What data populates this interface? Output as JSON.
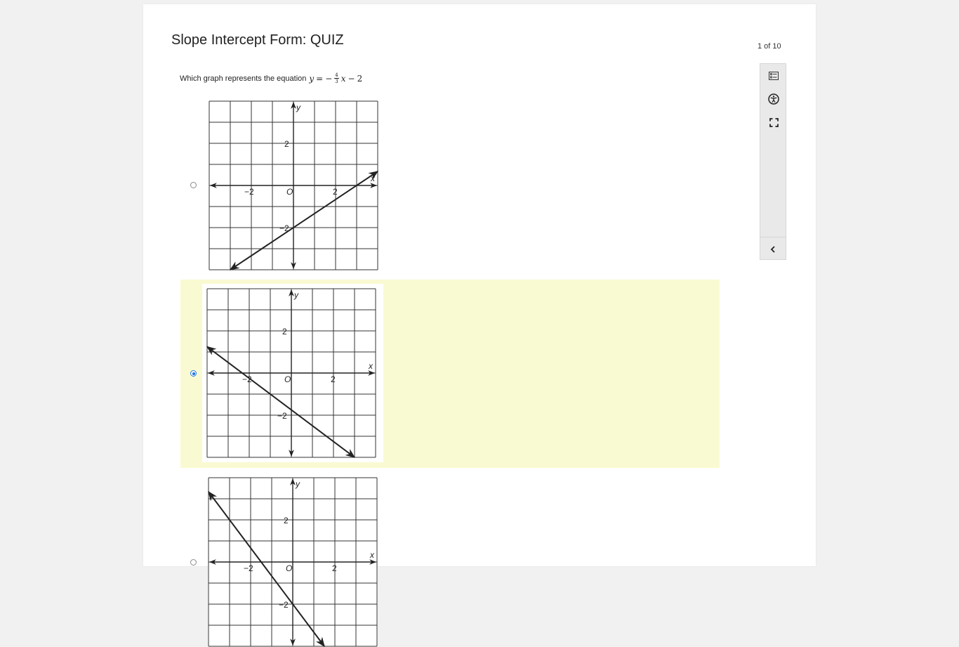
{
  "quiz": {
    "title": "Slope Intercept Form: QUIZ",
    "counter": "1 of 10"
  },
  "question": {
    "text": "Which graph represents the equation",
    "equation": {
      "lhs": "y",
      "equals": "=",
      "sign": "−",
      "numerator": "4",
      "denominator": "3",
      "variable": "x",
      "op": "−",
      "constant": "2"
    }
  },
  "options": [
    {
      "selected": false,
      "labels": {
        "y": "y",
        "x": "x",
        "origin": "O",
        "neg2": "−2",
        "pos2": "2"
      },
      "line": {
        "slope": 0.6667,
        "intercept": -2
      }
    },
    {
      "selected": true,
      "labels": {
        "y": "y",
        "x": "x",
        "origin": "O",
        "neg2": "−2",
        "pos2": "2"
      },
      "line": {
        "slope": -0.75,
        "intercept": -1.75
      }
    },
    {
      "selected": false,
      "labels": {
        "y": "y",
        "x": "x",
        "origin": "O",
        "neg2": "−2",
        "pos2": "2"
      },
      "line": {
        "slope": -1.3333,
        "intercept": -2
      }
    }
  ],
  "toolbar": {
    "icons": [
      "list-checklist-icon",
      "accessibility-icon",
      "fullscreen-icon"
    ],
    "collapse_icon": "chevron-left-icon"
  },
  "colors": {
    "selected_highlight": "#fafad2",
    "radio_selected": "#1a73e8"
  }
}
